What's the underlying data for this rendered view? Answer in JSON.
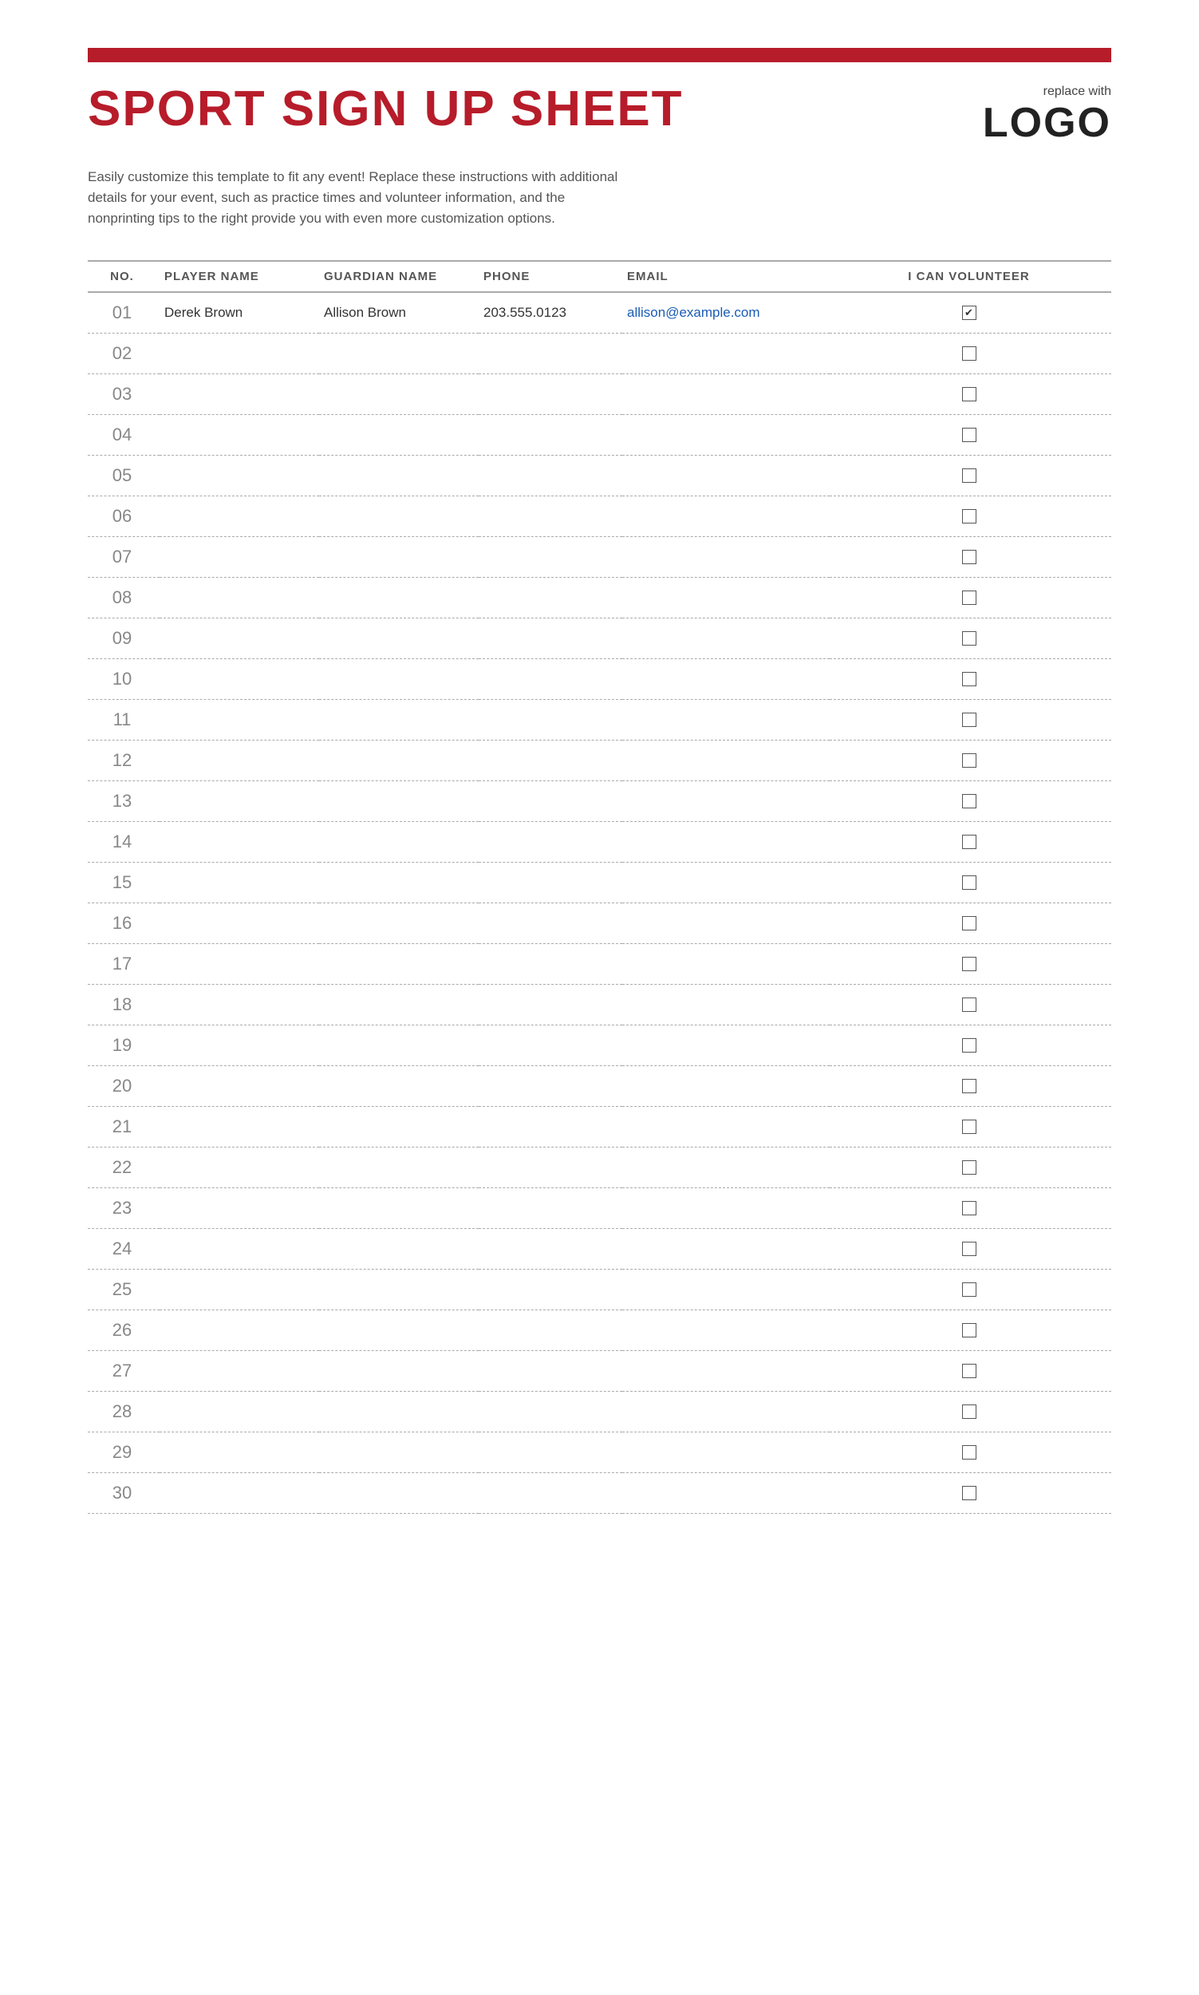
{
  "page": {
    "red_bar": "",
    "title": "Sport Sign Up Sheet",
    "logo_small": "replace with",
    "logo_big": "LOGO",
    "description": "Easily customize this template to fit any event! Replace these instructions with additional details for your event, such as practice times and volunteer information, and the nonprinting tips to the right provide you with even more customization options.",
    "table": {
      "headers": {
        "no": "NO.",
        "player_name": "PLAYER NAME",
        "guardian_name": "GUARDIAN NAME",
        "phone": "PHONE",
        "email": "EMAIL",
        "volunteer": "I CAN VOLUNTEER"
      },
      "rows": [
        {
          "no": "01",
          "player": "Derek Brown",
          "guardian": "Allison Brown",
          "phone": "203.555.0123",
          "email": "allison@example.com",
          "checked": true
        },
        {
          "no": "02",
          "player": "",
          "guardian": "",
          "phone": "",
          "email": "",
          "checked": false
        },
        {
          "no": "03",
          "player": "",
          "guardian": "",
          "phone": "",
          "email": "",
          "checked": false
        },
        {
          "no": "04",
          "player": "",
          "guardian": "",
          "phone": "",
          "email": "",
          "checked": false
        },
        {
          "no": "05",
          "player": "",
          "guardian": "",
          "phone": "",
          "email": "",
          "checked": false
        },
        {
          "no": "06",
          "player": "",
          "guardian": "",
          "phone": "",
          "email": "",
          "checked": false
        },
        {
          "no": "07",
          "player": "",
          "guardian": "",
          "phone": "",
          "email": "",
          "checked": false
        },
        {
          "no": "08",
          "player": "",
          "guardian": "",
          "phone": "",
          "email": "",
          "checked": false
        },
        {
          "no": "09",
          "player": "",
          "guardian": "",
          "phone": "",
          "email": "",
          "checked": false
        },
        {
          "no": "10",
          "player": "",
          "guardian": "",
          "phone": "",
          "email": "",
          "checked": false
        },
        {
          "no": "11",
          "player": "",
          "guardian": "",
          "phone": "",
          "email": "",
          "checked": false
        },
        {
          "no": "12",
          "player": "",
          "guardian": "",
          "phone": "",
          "email": "",
          "checked": false
        },
        {
          "no": "13",
          "player": "",
          "guardian": "",
          "phone": "",
          "email": "",
          "checked": false
        },
        {
          "no": "14",
          "player": "",
          "guardian": "",
          "phone": "",
          "email": "",
          "checked": false
        },
        {
          "no": "15",
          "player": "",
          "guardian": "",
          "phone": "",
          "email": "",
          "checked": false
        },
        {
          "no": "16",
          "player": "",
          "guardian": "",
          "phone": "",
          "email": "",
          "checked": false
        },
        {
          "no": "17",
          "player": "",
          "guardian": "",
          "phone": "",
          "email": "",
          "checked": false
        },
        {
          "no": "18",
          "player": "",
          "guardian": "",
          "phone": "",
          "email": "",
          "checked": false
        },
        {
          "no": "19",
          "player": "",
          "guardian": "",
          "phone": "",
          "email": "",
          "checked": false
        },
        {
          "no": "20",
          "player": "",
          "guardian": "",
          "phone": "",
          "email": "",
          "checked": false
        },
        {
          "no": "21",
          "player": "",
          "guardian": "",
          "phone": "",
          "email": "",
          "checked": false
        },
        {
          "no": "22",
          "player": "",
          "guardian": "",
          "phone": "",
          "email": "",
          "checked": false
        },
        {
          "no": "23",
          "player": "",
          "guardian": "",
          "phone": "",
          "email": "",
          "checked": false
        },
        {
          "no": "24",
          "player": "",
          "guardian": "",
          "phone": "",
          "email": "",
          "checked": false
        },
        {
          "no": "25",
          "player": "",
          "guardian": "",
          "phone": "",
          "email": "",
          "checked": false
        },
        {
          "no": "26",
          "player": "",
          "guardian": "",
          "phone": "",
          "email": "",
          "checked": false
        },
        {
          "no": "27",
          "player": "",
          "guardian": "",
          "phone": "",
          "email": "",
          "checked": false
        },
        {
          "no": "28",
          "player": "",
          "guardian": "",
          "phone": "",
          "email": "",
          "checked": false
        },
        {
          "no": "29",
          "player": "",
          "guardian": "",
          "phone": "",
          "email": "",
          "checked": false
        },
        {
          "no": "30",
          "player": "",
          "guardian": "",
          "phone": "",
          "email": "",
          "checked": false
        }
      ]
    }
  }
}
